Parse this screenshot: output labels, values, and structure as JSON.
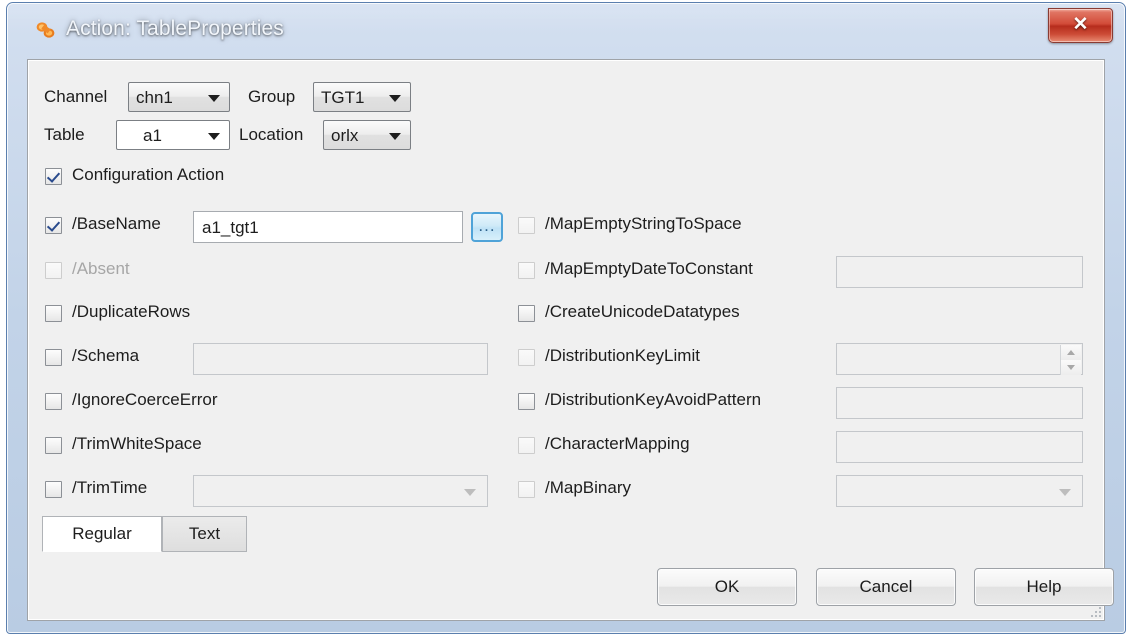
{
  "window": {
    "title": "Action: TableProperties",
    "icon": "beads-icon",
    "close_label": "✕",
    "close_icon": "close-icon"
  },
  "header": {
    "channel_label": "Channel",
    "channel_value": "chn1",
    "group_label": "Group",
    "group_value": "TGT1",
    "table_label": "Table",
    "table_value": "a1",
    "location_label": "Location",
    "location_value": "orlx",
    "configuration_action_label": "Configuration Action",
    "configuration_action_checked": true
  },
  "options": {
    "left_column": [
      {
        "label": "/BaseName",
        "checked": true,
        "disabled": false,
        "control": "text",
        "value": "a1_tgt1",
        "has_browse": true,
        "browse_label": "..."
      },
      {
        "label": "/Absent",
        "checked": false,
        "disabled": true,
        "control": "none",
        "value": ""
      },
      {
        "label": "/DuplicateRows",
        "checked": false,
        "disabled": false,
        "control": "none",
        "value": ""
      },
      {
        "label": "/Schema",
        "checked": false,
        "disabled": false,
        "control": "text-readonly",
        "value": ""
      },
      {
        "label": "/IgnoreCoerceError",
        "checked": false,
        "disabled": false,
        "control": "none",
        "value": ""
      },
      {
        "label": "/TrimWhiteSpace",
        "checked": false,
        "disabled": false,
        "control": "none",
        "value": ""
      },
      {
        "label": "/TrimTime",
        "checked": false,
        "disabled": false,
        "control": "dropdown",
        "value": ""
      }
    ],
    "right_column": [
      {
        "label": "/MapEmptyStringToSpace",
        "checked": false,
        "disabled": false,
        "control": "none",
        "value": ""
      },
      {
        "label": "/MapEmptyDateToConstant",
        "checked": false,
        "disabled": false,
        "control": "text-readonly",
        "value": ""
      },
      {
        "label": "/CreateUnicodeDatatypes",
        "checked": false,
        "disabled": false,
        "control": "none",
        "value": ""
      },
      {
        "label": "/DistributionKeyLimit",
        "checked": false,
        "disabled": false,
        "control": "spinner",
        "value": ""
      },
      {
        "label": "/DistributionKeyAvoidPattern",
        "checked": false,
        "disabled": false,
        "control": "text-readonly",
        "value": ""
      },
      {
        "label": "/CharacterMapping",
        "checked": false,
        "disabled": false,
        "control": "text-readonly",
        "value": ""
      },
      {
        "label": "/MapBinary",
        "checked": false,
        "disabled": false,
        "control": "dropdown",
        "value": ""
      }
    ]
  },
  "tabs": [
    {
      "label": "Regular",
      "active": true
    },
    {
      "label": "Text",
      "active": false
    }
  ],
  "buttons": [
    {
      "label": "OK",
      "name": "ok-button"
    },
    {
      "label": "Cancel",
      "name": "cancel-button"
    },
    {
      "label": "Help",
      "name": "help-button"
    }
  ],
  "colors": {
    "titlebar_dark": "#1b4286",
    "titlebar_light": "#7ba5d3",
    "close_red": "#d24b38",
    "panel_bg": "#f0f0f0",
    "frame_blue": "#b9cce3",
    "focus_blue": "#4fa3d8",
    "check_blue": "#2a4b8d"
  }
}
